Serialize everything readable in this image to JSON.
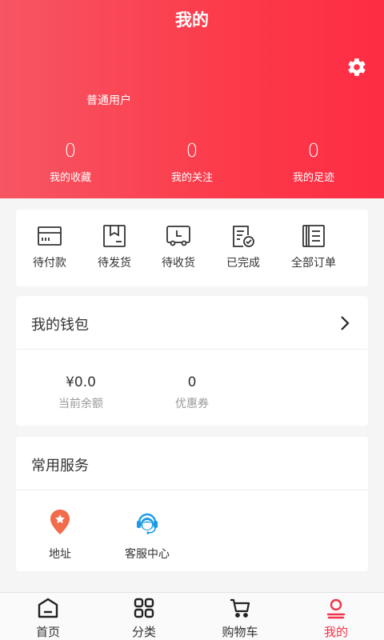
{
  "header": {
    "title": "我的",
    "username": "普通用户",
    "stats": [
      {
        "value": "0",
        "label": "我的收藏"
      },
      {
        "value": "0",
        "label": "我的关注"
      },
      {
        "value": "0",
        "label": "我的足迹"
      }
    ]
  },
  "orders": [
    {
      "label": "待付款",
      "icon": "wallet-card-icon"
    },
    {
      "label": "待发货",
      "icon": "box-icon"
    },
    {
      "label": "待收货",
      "icon": "truck-icon"
    },
    {
      "label": "已完成",
      "icon": "checked-doc-icon"
    },
    {
      "label": "全部订单",
      "icon": "list-icon"
    }
  ],
  "wallet": {
    "title": "我的钱包",
    "balance": {
      "value": "¥0.0",
      "label": "当前余额"
    },
    "coupons": {
      "value": "0",
      "label": "优惠券"
    }
  },
  "services": {
    "title": "常用服务",
    "items": [
      {
        "label": "地址",
        "icon": "location-pin-icon",
        "color": "#f26b4b"
      },
      {
        "label": "客服中心",
        "icon": "customer-service-icon",
        "color": "#1a9be6"
      }
    ]
  },
  "tabbar": [
    {
      "label": "首页",
      "icon": "home-icon"
    },
    {
      "label": "分类",
      "icon": "category-icon"
    },
    {
      "label": "购物车",
      "icon": "cart-icon"
    },
    {
      "label": "我的",
      "icon": "user-icon",
      "active": true
    }
  ],
  "colors": {
    "accent": "#f4344a",
    "header_start": "#f75563",
    "header_end": "#fe2c44"
  }
}
